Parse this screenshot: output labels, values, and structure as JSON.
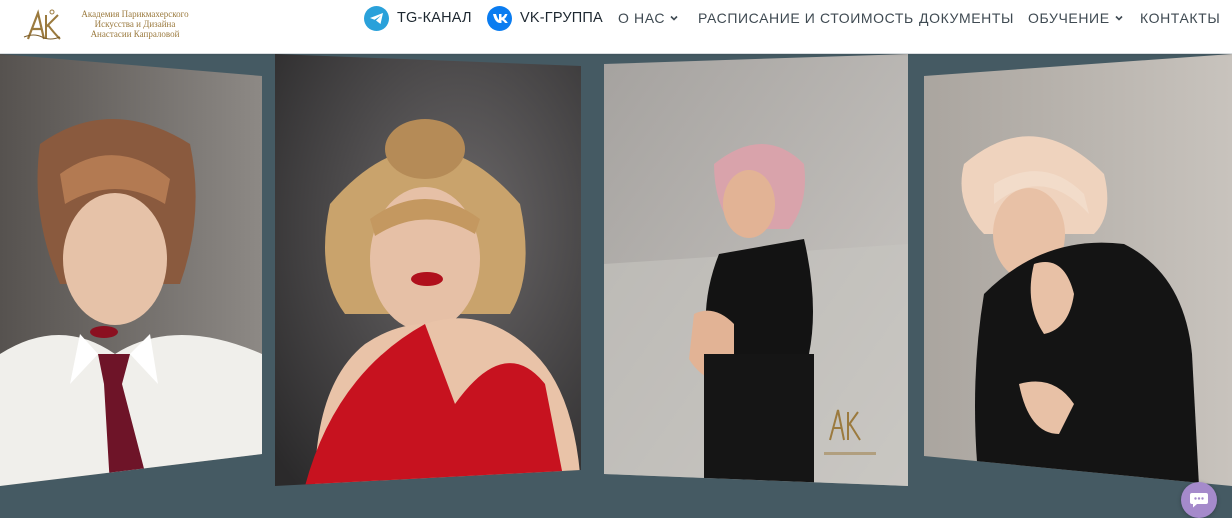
{
  "logo": {
    "lines": [
      "Академия Парикмахерского",
      "Искусства и Дизайна",
      "Анастасии Капраловой"
    ],
    "icon": "academy-monogram-logo"
  },
  "nav": {
    "telegram": {
      "label": "TG-КАНАЛ",
      "icon": "telegram-icon",
      "color": "#2aa1da"
    },
    "vk": {
      "label": "VK-ГРУППА",
      "icon": "vk-icon",
      "color": "#0077ff"
    },
    "about": {
      "label": "О НАС",
      "icon": "chevron-down-icon"
    },
    "schedule": {
      "label": "РАСПИСАНИЕ И СТОИМОСТЬ"
    },
    "documents": {
      "label": "ДОКУМЕНТЫ"
    },
    "education": {
      "label": "ОБУЧЕНИЕ",
      "icon": "chevron-down-icon"
    },
    "contacts": {
      "label": "КОНТАКТЫ"
    }
  },
  "gallery": {
    "background": "#455a63",
    "photos": [
      {
        "name": "model-white-shirt-tie"
      },
      {
        "name": "model-red-dress-blonde-bob"
      },
      {
        "name": "model-pink-hair-black-outfit"
      },
      {
        "name": "model-platinum-hair-black-dress"
      }
    ]
  },
  "chat": {
    "icon": "chat-bubble-icon",
    "color": "#a58acb"
  },
  "colors": {
    "header_bg": "#ffffff",
    "nav_text": "#3f4a52",
    "logo_gold": "#9b7a3e"
  }
}
